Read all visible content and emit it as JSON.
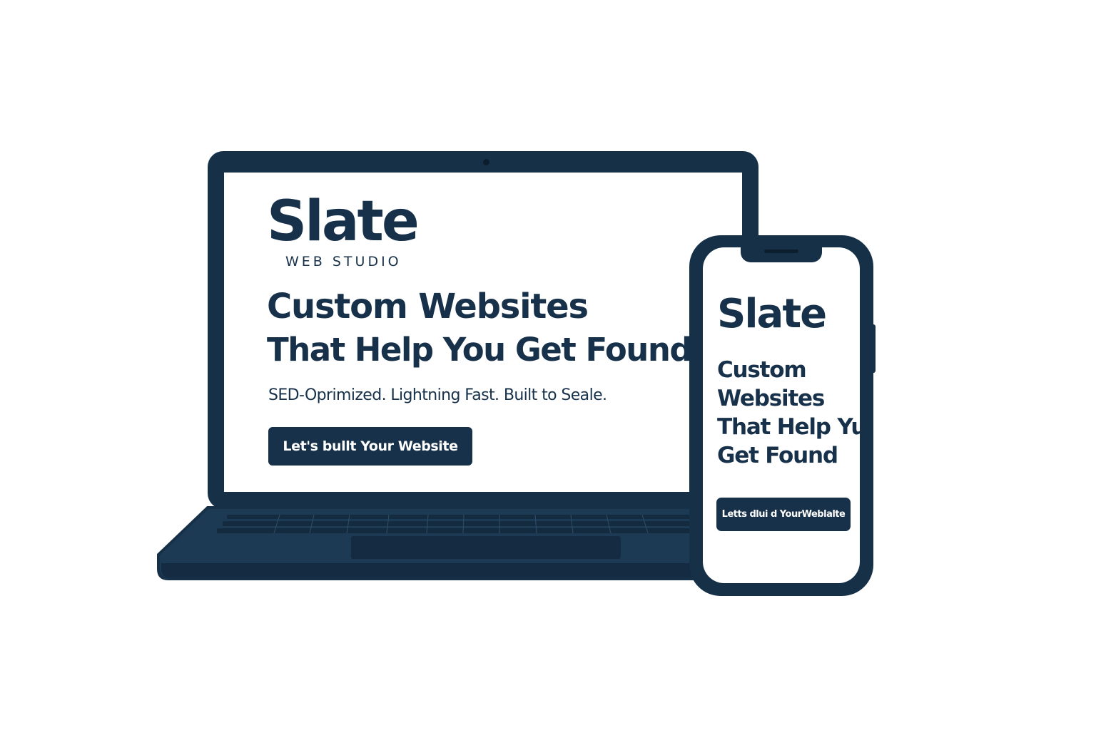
{
  "colors": {
    "device_frame": "#163047",
    "brand_navy": "#17314a",
    "screen_background": "#ffffff",
    "button_text": "#ffffff"
  },
  "laptop": {
    "logo": "Slate",
    "logo_subtitle": "WEB STUDIO",
    "headline_line1": "Custom Websites",
    "headline_line2": "That Help You Get Found",
    "tagline": "SED-Oprimized. Lightning Fast. Built to Seale.",
    "cta_label": "Let's bullt Your Website"
  },
  "phone": {
    "logo": "Slate",
    "headline_lines": [
      "Custom",
      "Websites",
      "That Help Yu",
      "Get Found"
    ],
    "cta_label": "Letts dlui d YourWeblalte"
  }
}
